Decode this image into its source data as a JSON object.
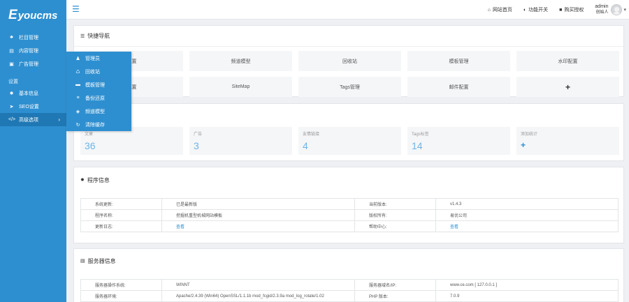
{
  "brand": {
    "logo_big": "E",
    "logo_rest": "youcms"
  },
  "sidebar": {
    "items": [
      {
        "icon": "sitemap-icon",
        "glyph": "♣",
        "label": "栏目管理"
      },
      {
        "icon": "list-icon",
        "glyph": "▤",
        "label": "内容管理"
      },
      {
        "icon": "image-icon",
        "glyph": "▣",
        "label": "广告管理"
      }
    ],
    "section": "设置",
    "settings": [
      {
        "icon": "gear-icon",
        "glyph": "✹",
        "label": "基本信息"
      },
      {
        "icon": "send-icon",
        "glyph": "➤",
        "label": "SEO设置"
      },
      {
        "icon": "code-icon",
        "glyph": "</>",
        "label": "高级选项",
        "arrow": "›"
      }
    ]
  },
  "submenu": {
    "items": [
      {
        "icon": "user-icon",
        "glyph": "♟",
        "label": "管理员"
      },
      {
        "icon": "recycle-icon",
        "glyph": "♺",
        "label": "回收站"
      },
      {
        "icon": "folder-icon",
        "glyph": "▬",
        "label": "模板管理"
      },
      {
        "icon": "database-icon",
        "glyph": "≡",
        "label": "备份还原"
      },
      {
        "icon": "cube-icon",
        "glyph": "◈",
        "label": "频道模型"
      },
      {
        "icon": "refresh-icon",
        "glyph": "↻",
        "label": "清除缓存"
      }
    ]
  },
  "topbar": {
    "links": [
      {
        "icon": "home-icon",
        "glyph": "⌂",
        "label": "网站首页"
      },
      {
        "icon": "toggle-icon",
        "glyph": "◐",
        "label": "功能开关"
      },
      {
        "icon": "bookmark-icon",
        "glyph": "■",
        "label": "购买授权"
      }
    ],
    "user": {
      "name": "admin",
      "role": "创始人"
    }
  },
  "quick_nav": {
    "title": "快捷导航",
    "items": [
      "配置",
      "频道模型",
      "回收站",
      "模板管理",
      "水印配置",
      "配置",
      "SiteMap",
      "Tags管理",
      "邮件配置",
      "+"
    ]
  },
  "stats": [
    {
      "label": "文章",
      "value": "36"
    },
    {
      "label": "广告",
      "value": "3"
    },
    {
      "label": "友情链接",
      "value": "4"
    },
    {
      "label": "Tags标签",
      "value": "14"
    },
    {
      "label": "添加统计",
      "value": "+"
    }
  ],
  "program_info": {
    "title": "程序信息",
    "rows": [
      {
        "k1": "系统更新:",
        "v1": "已是最新版",
        "k2": "当前版本:",
        "v2": "v1.4.3"
      },
      {
        "k1": "程序名称:",
        "v1": "挖掘机重型机械网站模板",
        "k2": "版权所有:",
        "v2": "易优公司"
      },
      {
        "k1": "更新日志:",
        "v1": "查看",
        "k2": "帮助中心:",
        "v2": "查看"
      }
    ]
  },
  "server_info": {
    "title": "服务器信息",
    "rows": [
      {
        "k1": "服务器操作系统:",
        "v1": "WINNT",
        "k2": "服务器域名/IP:",
        "v2": "www.ce.com [ 127.0.0.1 ]"
      },
      {
        "k1": "服务器环境:",
        "v1": "Apache/2.4.39 (Win64) OpenSSL/1.1.1b mod_fcgid/2.3.9a mod_log_rotate/1.02",
        "k2": "PHP 版本:",
        "v2": "7.0.9"
      }
    ]
  }
}
